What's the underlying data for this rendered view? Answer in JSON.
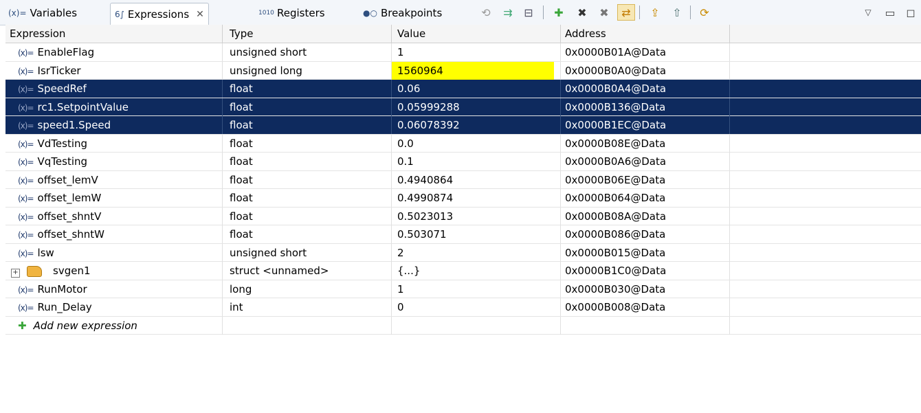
{
  "toolbar": {
    "tabs": [
      {
        "label": "Variables",
        "icon": "variables-icon",
        "glyph": "(x)="
      },
      {
        "label": "Expressions",
        "icon": "expressions-icon",
        "glyph": "6∫",
        "close": "✕"
      },
      {
        "label": "Registers",
        "icon": "registers-icon",
        "glyph": "1010"
      },
      {
        "label": "Breakpoints",
        "icon": "breakpoints-icon",
        "glyph": "●○"
      }
    ]
  },
  "table": {
    "columns": [
      "Expression",
      "Type",
      "Value",
      "Address"
    ],
    "rows": [
      {
        "expr": "EnableFlag",
        "type": "unsigned short",
        "value": "1",
        "address": "0x0000B01A@Data"
      },
      {
        "expr": "IsrTicker",
        "type": "unsigned long",
        "value": "1560964",
        "address": "0x0000B0A0@Data",
        "changed": true
      },
      {
        "expr": "SpeedRef",
        "type": "float",
        "value": "0.06",
        "address": "0x0000B0A4@Data",
        "selected": true
      },
      {
        "expr": "rc1.SetpointValue",
        "type": "float",
        "value": "0.05999288",
        "address": "0x0000B136@Data",
        "selected": true
      },
      {
        "expr": "speed1.Speed",
        "type": "float",
        "value": "0.06078392",
        "address": "0x0000B1EC@Data",
        "selected": true
      },
      {
        "expr": "VdTesting",
        "type": "float",
        "value": "0.0",
        "address": "0x0000B08E@Data"
      },
      {
        "expr": "VqTesting",
        "type": "float",
        "value": "0.1",
        "address": "0x0000B0A6@Data"
      },
      {
        "expr": "offset_lemV",
        "type": "float",
        "value": "0.4940864",
        "address": "0x0000B06E@Data"
      },
      {
        "expr": "offset_lemW",
        "type": "float",
        "value": "0.4990874",
        "address": "0x0000B064@Data"
      },
      {
        "expr": "offset_shntV",
        "type": "float",
        "value": "0.5023013",
        "address": "0x0000B08A@Data"
      },
      {
        "expr": "offset_shntW",
        "type": "float",
        "value": "0.503071",
        "address": "0x0000B086@Data"
      },
      {
        "expr": "lsw",
        "type": "unsigned short",
        "value": "2",
        "address": "0x0000B015@Data"
      },
      {
        "expr": "svgen1",
        "type": "struct <unnamed>",
        "value": "{...}",
        "address": "0x0000B1C0@Data",
        "struct": true
      },
      {
        "expr": "RunMotor",
        "type": "long",
        "value": "1",
        "address": "0x0000B030@Data"
      },
      {
        "expr": "Run_Delay",
        "type": "int",
        "value": "0",
        "address": "0x0000B008@Data"
      }
    ],
    "add_label": "Add new expression"
  },
  "colors": {
    "selected_row": "#0e2a5e",
    "changed_value": "#ffff00"
  }
}
